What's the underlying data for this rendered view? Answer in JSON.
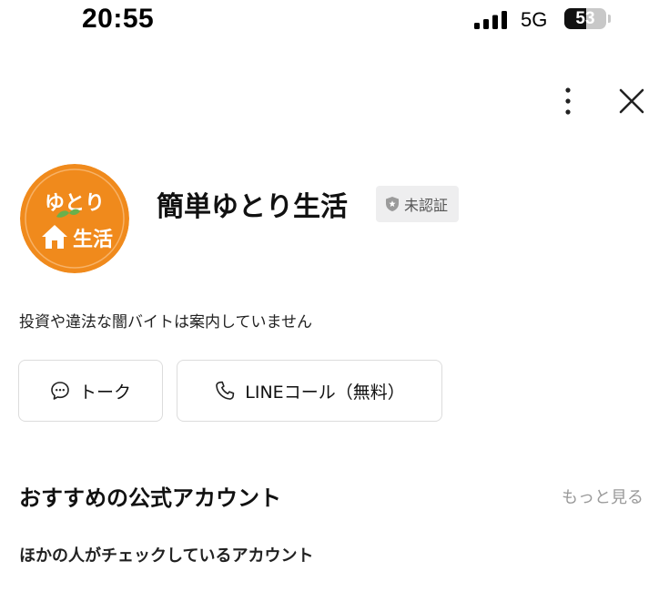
{
  "status_bar": {
    "time": "20:55",
    "network": "5G",
    "battery": "53",
    "battery_level": 0.53
  },
  "header": {
    "more_icon": "vertical-ellipsis-icon",
    "close_icon": "close-icon"
  },
  "profile": {
    "name": "簡単ゆとり生活",
    "badge": "未認証",
    "description": "投資や違法な闇バイトは案内していません",
    "avatar": {
      "line1": "ゆとり",
      "line2": "生活",
      "bg_color": "#f08a1c"
    }
  },
  "actions": {
    "talk": "トーク",
    "call": "LINEコール（無料）"
  },
  "recommended": {
    "title": "おすすめの公式アカウント",
    "more": "もっと見る",
    "subtitle": "ほかの人がチェックしているアカウント"
  },
  "colors": {
    "avatar_orange": "#f08a1c",
    "leaf_green": "#6ab04c",
    "muted_text": "#9a9a9a",
    "badge_bg": "#eeeeef"
  }
}
